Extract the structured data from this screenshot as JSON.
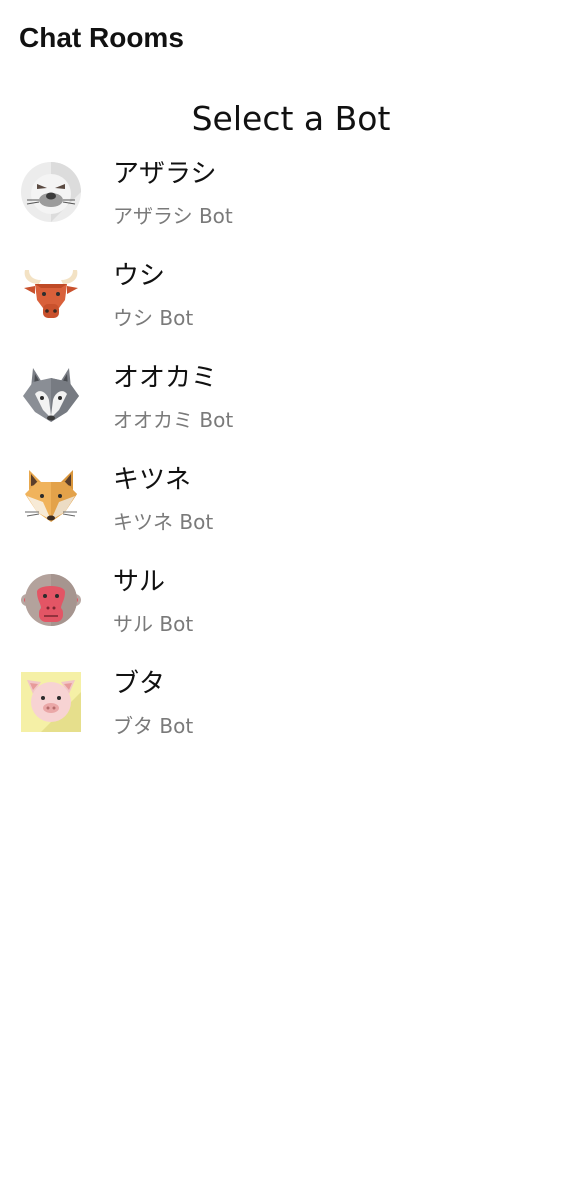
{
  "app_bar": {
    "title": "Chat Rooms"
  },
  "screen": {
    "heading": "Select a Bot"
  },
  "bots": [
    {
      "name": "アザラシ",
      "subtitle": "アザラシ Bot",
      "icon": "seal-icon"
    },
    {
      "name": "ウシ",
      "subtitle": "ウシ Bot",
      "icon": "cow-icon"
    },
    {
      "name": "オオカミ",
      "subtitle": "オオカミ Bot",
      "icon": "wolf-icon"
    },
    {
      "name": "キツネ",
      "subtitle": "キツネ Bot",
      "icon": "fox-icon"
    },
    {
      "name": "サル",
      "subtitle": "サル Bot",
      "icon": "monkey-icon"
    },
    {
      "name": "ブタ",
      "subtitle": "ブタ Bot",
      "icon": "pig-icon"
    }
  ]
}
